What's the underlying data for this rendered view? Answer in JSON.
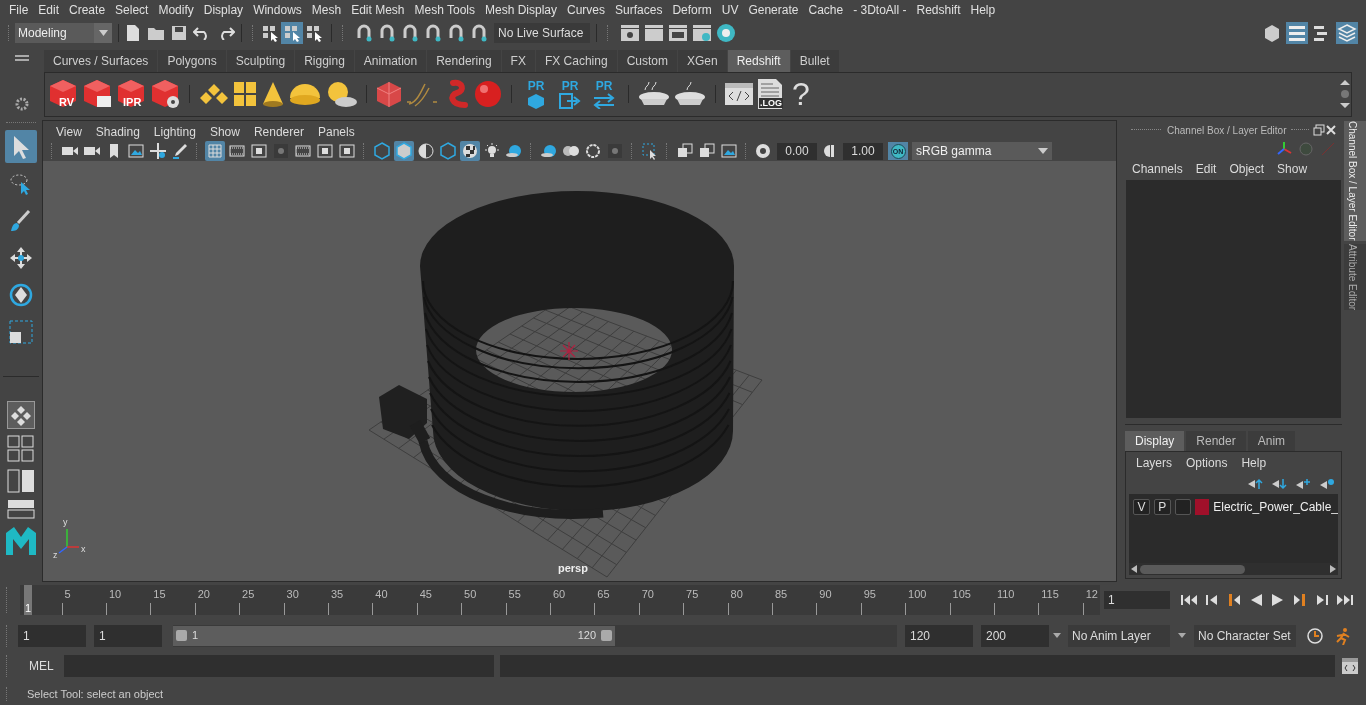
{
  "menu_bar": [
    "File",
    "Edit",
    "Create",
    "Select",
    "Modify",
    "Display",
    "Windows",
    "Mesh",
    "Edit Mesh",
    "Mesh Tools",
    "Mesh Display",
    "Curves",
    "Surfaces",
    "Deform",
    "UV",
    "Generate",
    "Cache",
    "- 3DtoAll -",
    "Redshift",
    "Help"
  ],
  "toolbar": {
    "workspace": "Modeling",
    "selection_modes": [
      {
        "selected": false
      },
      {
        "selected": true
      },
      {
        "selected": false
      }
    ],
    "live_surface": "No Live Surface"
  },
  "shelf": {
    "tabs": [
      {
        "label": "Curves / Surfaces",
        "selected": false
      },
      {
        "label": "Polygons",
        "selected": false
      },
      {
        "label": "Sculpting",
        "selected": false
      },
      {
        "label": "Rigging",
        "selected": false
      },
      {
        "label": "Animation",
        "selected": false
      },
      {
        "label": "Rendering",
        "selected": false
      },
      {
        "label": "FX",
        "selected": false
      },
      {
        "label": "FX Caching",
        "selected": false
      },
      {
        "label": "Custom",
        "selected": false
      },
      {
        "label": "XGen",
        "selected": false
      },
      {
        "label": "Redshift",
        "selected": true
      },
      {
        "label": "Bullet",
        "selected": false
      }
    ],
    "icon_labels": [
      "RV",
      "IPR",
      "PR",
      "PR",
      "PR",
      ".LOG",
      "?"
    ]
  },
  "tools": [
    {
      "kind": "select",
      "selected": true
    },
    {
      "kind": "lasso",
      "selected": false
    },
    {
      "kind": "paint",
      "selected": false
    },
    {
      "kind": "move",
      "selected": false
    },
    {
      "kind": "rotate",
      "selected": false
    },
    {
      "kind": "scale",
      "selected": false
    }
  ],
  "viewport": {
    "menu": [
      "View",
      "Shading",
      "Lighting",
      "Show",
      "Renderer",
      "Panels"
    ],
    "tool_groups": [
      [
        {
          "kind": "camera",
          "on": false
        },
        {
          "kind": "camera",
          "on": false
        },
        {
          "kind": "bookmark",
          "on": false
        },
        {
          "kind": "plane",
          "on": false
        },
        {
          "kind": "pan",
          "on": false
        },
        {
          "kind": "pencil",
          "on": false
        }
      ],
      [
        {
          "kind": "grid",
          "on": true
        },
        {
          "kind": "film",
          "on": false
        },
        {
          "kind": "gate",
          "on": false
        },
        {
          "kind": "dot",
          "on": false
        },
        {
          "kind": "film",
          "on": false
        },
        {
          "kind": "gate",
          "on": false
        },
        {
          "kind": "gate",
          "on": false
        }
      ],
      [
        {
          "kind": "cube",
          "on": false
        },
        {
          "kind": "cube",
          "on": true
        },
        {
          "kind": "half",
          "on": false
        },
        {
          "kind": "cube",
          "on": false
        },
        {
          "kind": "checker",
          "on": true
        },
        {
          "kind": "light",
          "on": false
        },
        {
          "kind": "sphere",
          "on": false
        }
      ],
      [
        {
          "kind": "sphere",
          "on": false
        },
        {
          "kind": "rings",
          "on": false
        },
        {
          "kind": "ring",
          "on": false
        },
        {
          "kind": "dot",
          "on": false
        }
      ],
      [
        {
          "kind": "select",
          "on": false
        }
      ],
      [
        {
          "kind": "panes",
          "on": false
        },
        {
          "kind": "panes",
          "on": false
        },
        {
          "kind": "plane",
          "on": false
        }
      ]
    ],
    "exposure": "0.00",
    "gamma": "1.00",
    "color_management": "ON",
    "view_transform": "sRGB gamma",
    "camera": "persp",
    "axis_labels": [
      "y",
      "z",
      "x"
    ]
  },
  "channel_box": {
    "title": "Channel Box / Layer Editor",
    "menu": [
      "Channels",
      "Edit",
      "Object",
      "Show"
    ]
  },
  "layer_editor": {
    "tabs": [
      {
        "label": "Display",
        "selected": true
      },
      {
        "label": "Render",
        "selected": false
      },
      {
        "label": "Anim",
        "selected": false
      }
    ],
    "menu": [
      "Layers",
      "Options",
      "Help"
    ],
    "layers": [
      {
        "visible": "V",
        "playback": "P",
        "color": "#a0102a",
        "name": "Electric_Power_Cable_"
      }
    ]
  },
  "side_tabs": [
    {
      "label": "Channel Box / Layer Editor",
      "selected": true
    },
    {
      "label": "Attribute Editor",
      "selected": false
    }
  ],
  "time_slider": {
    "ticks": [
      "5",
      "10",
      "15",
      "20",
      "25",
      "30",
      "35",
      "40",
      "45",
      "50",
      "55",
      "60",
      "65",
      "70",
      "75",
      "80",
      "85",
      "90",
      "95",
      "100",
      "105",
      "110",
      "115",
      "12"
    ],
    "current_frame": "1",
    "level": 0,
    "frame_field": "1"
  },
  "range_slider": {
    "start": "1",
    "playback_start": "1",
    "range_start": "1",
    "range_end": "120",
    "playback_end": "120",
    "end": "200",
    "anim_layer": "No Anim Layer",
    "character_set": "No Character Set"
  },
  "command_line": {
    "language": "MEL"
  },
  "status_line": "Select Tool: select an object"
}
